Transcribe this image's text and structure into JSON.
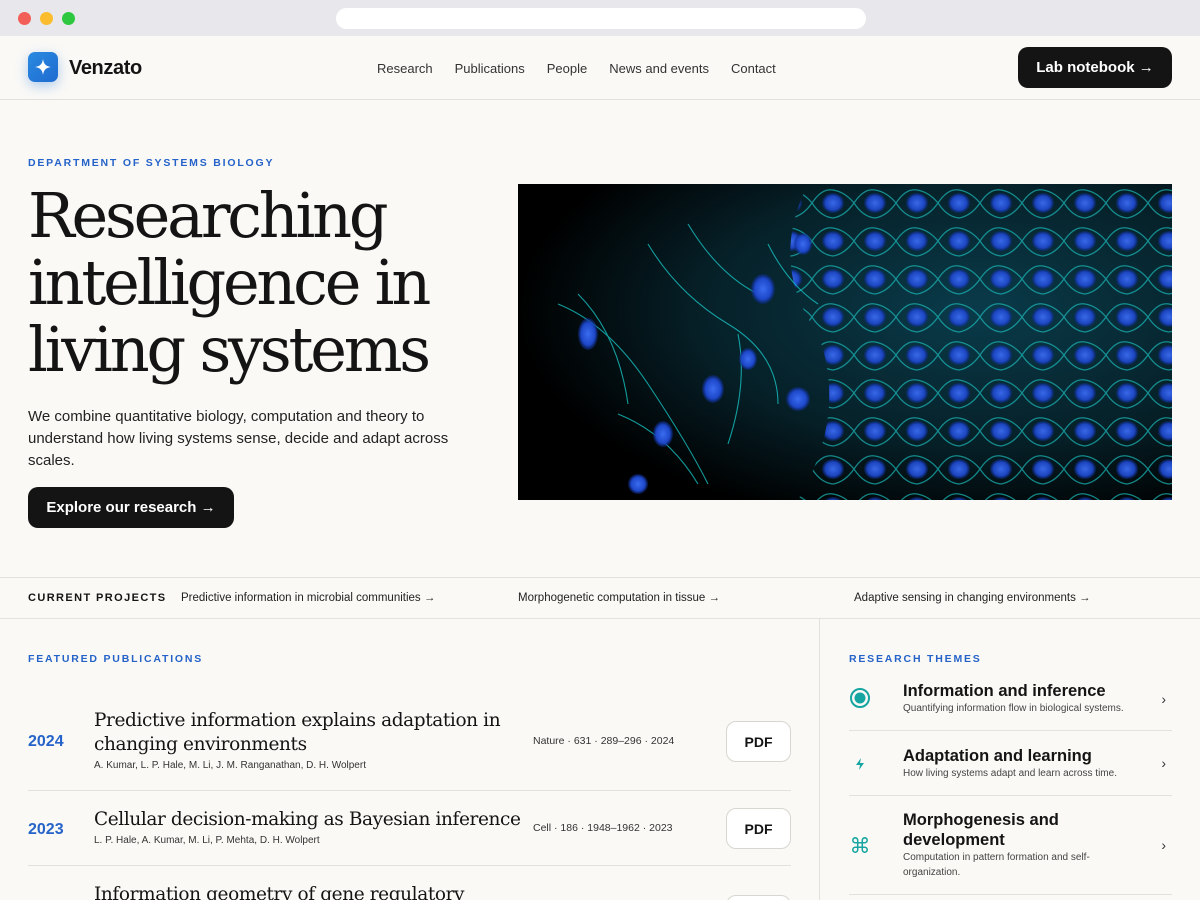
{
  "brand": {
    "name": "Venzato"
  },
  "nav": {
    "items": [
      {
        "label": "Research"
      },
      {
        "label": "Publications"
      },
      {
        "label": "People"
      },
      {
        "label": "News and events"
      },
      {
        "label": "Contact"
      }
    ],
    "cta_label": "Lab notebook →"
  },
  "hero": {
    "eyebrow": "DEPARTMENT OF SYSTEMS BIOLOGY",
    "title_lines": [
      "Researching",
      "intelligence in",
      "living systems"
    ],
    "description": "We combine quantitative biology, computation and theory to understand how living systems sense, decide and adapt across scales.",
    "cta_label": "Explore our research →"
  },
  "projects": {
    "label": "CURRENT PROJECTS",
    "items": [
      {
        "label": "Predictive information in microbial communities →"
      },
      {
        "label": "Morphogenetic computation in tissue →"
      },
      {
        "label": "Adaptive sensing in changing environments →"
      }
    ]
  },
  "publications": {
    "eyebrow": "FEATURED PUBLICATIONS",
    "items": [
      {
        "year": "2024",
        "title": "Predictive information explains adaptation in changing environments",
        "authors": "A. Kumar, L. P. Hale, M. Li, J. M. Ranganathan, D. H. Wolpert",
        "journal": "Nature · 631 · 289–296 · 2024",
        "pdf_label": "PDF"
      },
      {
        "year": "2023",
        "title": "Cellular decision-making as Bayesian inference",
        "authors": "L. P. Hale, A. Kumar, M. Li, P. Mehta, D. H. Wolpert",
        "journal": "Cell · 186 · 1948–1962 · 2023",
        "pdf_label": "PDF"
      },
      {
        "year": "",
        "title": "Information geometry of gene regulatory",
        "authors": "",
        "journal": "",
        "pdf_label": ""
      }
    ]
  },
  "themes": {
    "eyebrow": "RESEARCH THEMES",
    "items": [
      {
        "icon": "target-icon",
        "name": "Information and inference",
        "desc": "Quantifying information flow in biological systems."
      },
      {
        "icon": "lightning-icon",
        "name": "Adaptation and learning",
        "desc": "How living systems adapt and learn across time."
      },
      {
        "icon": "command-icon",
        "name": "Morphogenesis and development",
        "desc": "Computation in pattern formation and self-organization."
      }
    ]
  },
  "colors": {
    "accent": "#2563c9",
    "teal": "#16a5a0",
    "dark": "#141414"
  }
}
